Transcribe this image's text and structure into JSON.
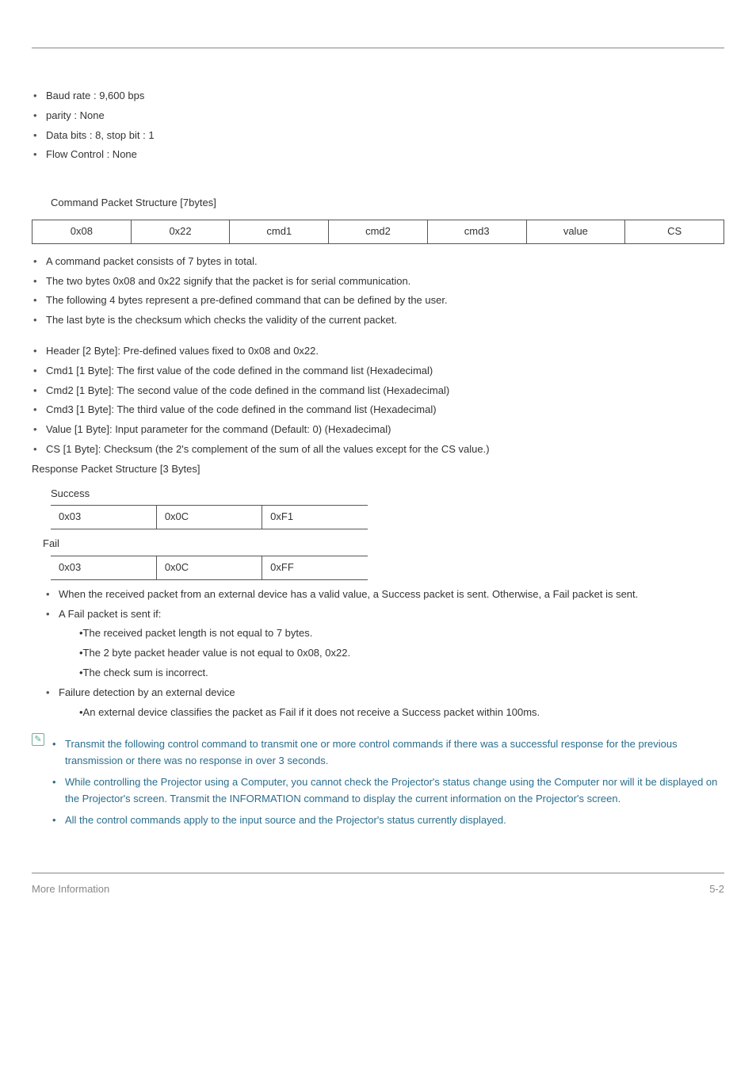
{
  "settings": {
    "items": [
      "Baud rate : 9,600 bps",
      "parity : None",
      "Data bits : 8, stop bit : 1",
      "Flow Control : None"
    ]
  },
  "packet_structure": {
    "title": "Command Packet Structure [7bytes]",
    "cells": [
      "0x08",
      "0x22",
      "cmd1",
      "cmd2",
      "cmd3",
      "value",
      "CS"
    ],
    "desc1": [
      "A command packet consists of 7 bytes in total.",
      "The two bytes 0x08 and 0x22 signify that the packet is for serial communication.",
      "The following 4 bytes represent a pre-defined command that can be defined by the user.",
      "The last byte is the checksum which checks the validity of the current packet."
    ],
    "desc2": [
      "Header [2 Byte]: Pre-defined values fixed to 0x08 and 0x22.",
      "Cmd1 [1 Byte]: The first value of the code defined in the command list (Hexadecimal)",
      "Cmd2 [1 Byte]: The second value of the code defined in the command list (Hexadecimal)",
      "Cmd3 [1 Byte]: The third value of the code defined in the command list (Hexadecimal)",
      "Value [1 Byte]: Input parameter for the command (Default: 0) (Hexadecimal)",
      "CS [1 Byte]: Checksum (the 2's complement of the sum of all the values except for the CS value.)"
    ]
  },
  "response": {
    "title": "Response Packet Structure [3 Bytes]",
    "success_label": "Success",
    "success_cells": [
      "0x03",
      "0x0C",
      "0xF1"
    ],
    "fail_label": "Fail",
    "fail_cells": [
      "0x03",
      "0x0C",
      "0xFF"
    ],
    "points": [
      "When the received packet from an external device has a valid value, a Success packet is sent. Otherwise, a Fail packet is sent.",
      "A Fail packet is sent if:"
    ],
    "fail_reasons": [
      "•The received packet length is not equal to 7 bytes.",
      "•The 2 byte packet header value is not equal to 0x08, 0x22.",
      "•The check sum is incorrect."
    ],
    "failure_detect_label": "Failure detection by an external device",
    "failure_detect_rule": "•An external device classifies the packet as Fail if it does not receive a Success packet within 100ms."
  },
  "notes": {
    "items": [
      "Transmit the following control command to transmit one or more control commands if there was a successful response for the previous transmission or there was no response in over 3 seconds.",
      "While controlling the Projector using a Computer, you cannot check the Projector's status change using the Computer nor will it be displayed on the Projector's screen. Transmit the INFORMATION command to display the current information on the Projector's screen.",
      "All the control commands apply to the input source and the Projector's status currently displayed."
    ]
  },
  "footer": {
    "left": "More Information",
    "right": "5-2"
  }
}
